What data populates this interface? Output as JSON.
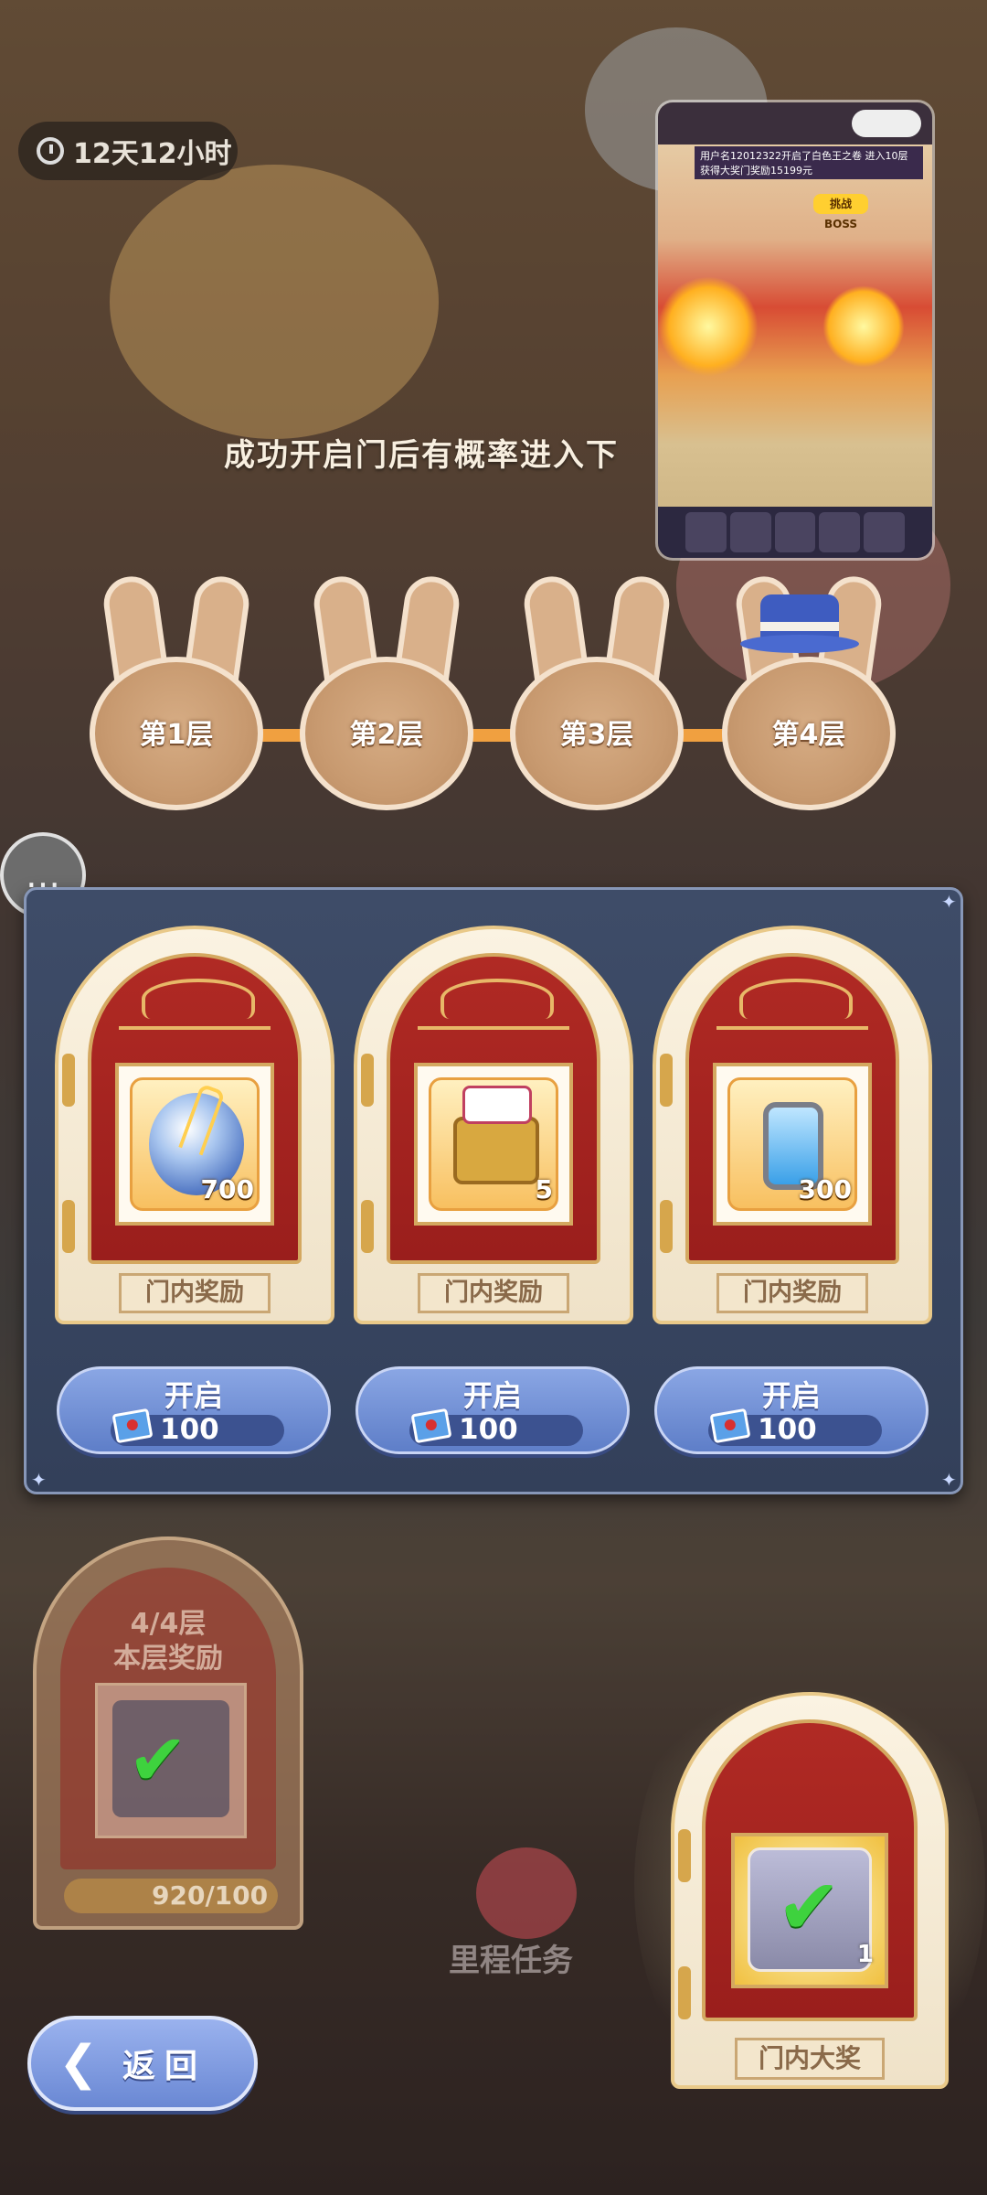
{
  "timer": {
    "text": "12天12小时"
  },
  "mini_window": {
    "boss_label": "挑战BOSS",
    "notice": "用户名12012322开启了白色王之卷 进入10层获得大奖门奖励15199元"
  },
  "banner": {
    "text": "成功开启门后有概率进入下"
  },
  "floors": [
    {
      "label": "第1层"
    },
    {
      "label": "第2层"
    },
    {
      "label": "第3层"
    },
    {
      "label": "第4层"
    }
  ],
  "doors": [
    {
      "icon": "crystal-orb-icon",
      "qty": "700",
      "plate": "门内奖励",
      "open_label": "开启",
      "cost": "100"
    },
    {
      "icon": "treasure-chest-icon",
      "qty": "5",
      "plate": "门内奖励",
      "open_label": "开启",
      "cost": "100"
    },
    {
      "icon": "energy-vial-icon",
      "qty": "300",
      "plate": "门内奖励",
      "open_label": "开启",
      "cost": "100"
    }
  ],
  "floor_reward": {
    "line1": "4/4层",
    "line2": "本层奖励",
    "progress": "920/100"
  },
  "milestone": {
    "label": "里程任务"
  },
  "grand_prize": {
    "plate": "门内大奖",
    "qty": "1"
  },
  "back_button": {
    "label": "返回"
  },
  "colors": {
    "accent_blue": "#6a88d4",
    "door_red": "#b02a24",
    "gold": "#e9c989",
    "check_green": "#3ed23e"
  }
}
